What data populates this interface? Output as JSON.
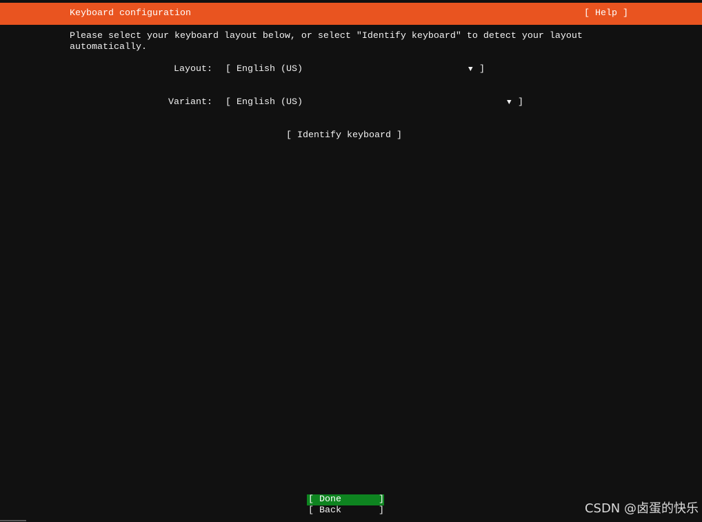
{
  "theme": {
    "background": "#111111",
    "accent": "#E95420",
    "focus": "#0E8420",
    "text": "#F2F2F2"
  },
  "brackets": {
    "open": "[",
    "close": "]"
  },
  "header": {
    "title": "Keyboard configuration",
    "help_label": "Help"
  },
  "intro": {
    "lines": [
      "Please select your keyboard layout below, or select \"Identify keyboard\" to detect your layout",
      "automatically."
    ]
  },
  "form": {
    "dropdown_arrow": "▼",
    "dropdown_icon": "triangle-down-icon",
    "layout": {
      "label": "Layout:",
      "value": "English (US)"
    },
    "variant": {
      "label": "Variant:",
      "value": "English (US)"
    },
    "identify_label": "Identify keyboard"
  },
  "footer": {
    "buttons": [
      {
        "label": "Done",
        "focused": true
      },
      {
        "label": "Back",
        "focused": false
      }
    ]
  },
  "watermark": "CSDN @卤蛋的快乐"
}
